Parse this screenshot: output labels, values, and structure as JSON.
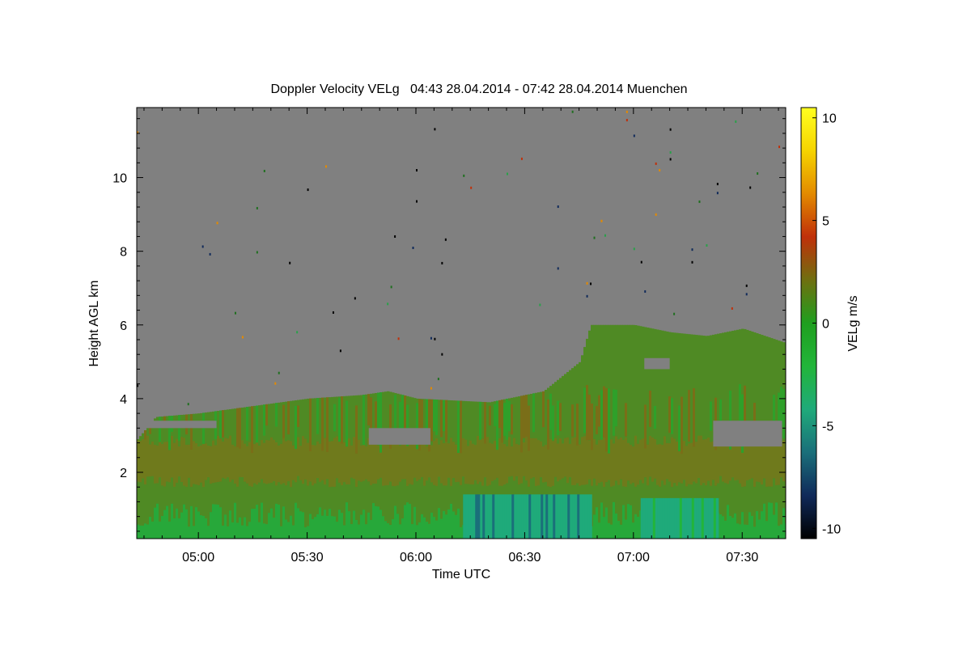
{
  "chart_data": {
    "type": "heatmap",
    "title": "Doppler Velocity VELg   04:43 28.04.2014 - 07:42 28.04.2014 Muenchen",
    "xlabel": "Time UTC",
    "ylabel": "Height AGL km",
    "x_range_utc": [
      "04:43",
      "07:42"
    ],
    "x_ticks": [
      "05:00",
      "05:30",
      "06:00",
      "06:30",
      "07:00",
      "07:30"
    ],
    "y_range_km": [
      0.2,
      11.9
    ],
    "y_ticks": [
      2,
      4,
      6,
      8,
      10
    ],
    "grid": false,
    "colorbar": {
      "label": "VELg m/s",
      "range": [
        -10.5,
        10.5
      ],
      "ticks": [
        10,
        5,
        0,
        -5,
        -10
      ],
      "colors": [
        "#000000",
        "#102a5a",
        "#1a6f7a",
        "#1faa7a",
        "#22b53a",
        "#1f9f1f",
        "#6f6f10",
        "#c0300a",
        "#e38a00",
        "#f6d400",
        "#ffff20"
      ]
    },
    "no_data_color": "#808080",
    "cloud_top_profile": [
      {
        "time": "04:43",
        "top_km": 2.9
      },
      {
        "time": "04:48",
        "top_km": 3.5
      },
      {
        "time": "05:00",
        "top_km": 3.6
      },
      {
        "time": "05:15",
        "top_km": 3.8
      },
      {
        "time": "05:30",
        "top_km": 4.0
      },
      {
        "time": "05:45",
        "top_km": 4.1
      },
      {
        "time": "05:52",
        "top_km": 4.2
      },
      {
        "time": "06:00",
        "top_km": 4.0
      },
      {
        "time": "06:20",
        "top_km": 3.9
      },
      {
        "time": "06:35",
        "top_km": 4.2
      },
      {
        "time": "06:45",
        "top_km": 5.0
      },
      {
        "time": "06:48",
        "top_km": 6.0
      },
      {
        "time": "07:00",
        "top_km": 6.0
      },
      {
        "time": "07:10",
        "top_km": 5.8
      },
      {
        "time": "07:20",
        "top_km": 5.7
      },
      {
        "time": "07:30",
        "top_km": 5.9
      },
      {
        "time": "07:42",
        "top_km": 5.5
      }
    ],
    "downdraft_regions": [
      {
        "start": "06:13",
        "end": "06:48",
        "bottom_km": 0.2,
        "top_km": 1.4,
        "velocity_ms": -4.5
      },
      {
        "start": "07:02",
        "end": "07:23",
        "bottom_km": 0.2,
        "top_km": 1.3,
        "velocity_ms": -4.0
      }
    ]
  }
}
